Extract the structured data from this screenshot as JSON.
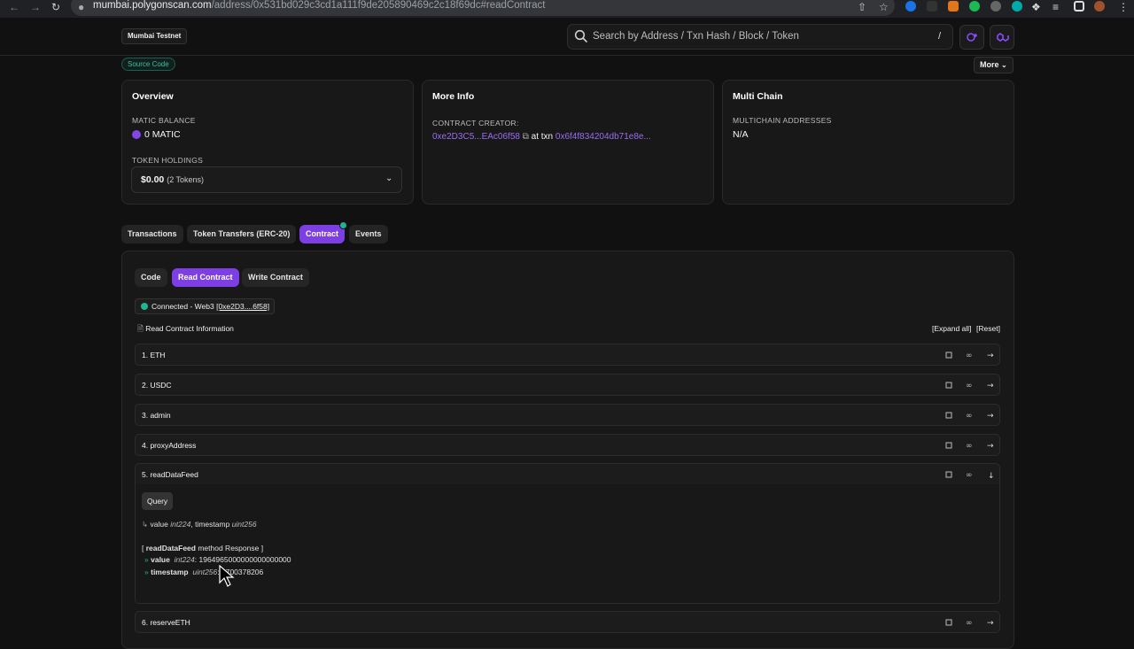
{
  "browser": {
    "url_host": "mumbai.polygonscan.com",
    "url_path": "/address/0x531bd029c3cd1a111f9de205890469c2c18f69dc#readContract"
  },
  "header": {
    "network": "Mumbai Testnet",
    "search_placeholder": "Search by Address / Txn Hash / Block / Token",
    "search_shortcut": "/"
  },
  "subheader": {
    "source_badge": "Source Code",
    "more_label": "More"
  },
  "overview": {
    "title": "Overview",
    "balance_label": "MATIC BALANCE",
    "balance_value": "0 MATIC",
    "holdings_label": "TOKEN HOLDINGS",
    "holdings_value": "$0.00",
    "holdings_count": "(2 Tokens)"
  },
  "more_info": {
    "title": "More Info",
    "creator_label": "CONTRACT CREATOR:",
    "creator_address": "0xe2D3C5...EAc06f58",
    "at_txn": "at txn",
    "creator_txn": "0x6f4f834204db71e8e..."
  },
  "multi_chain": {
    "title": "Multi Chain",
    "label": "MULTICHAIN ADDRESSES",
    "value": "N/A"
  },
  "tabs": [
    {
      "label": "Transactions"
    },
    {
      "label": "Token Transfers (ERC-20)"
    },
    {
      "label": "Contract"
    },
    {
      "label": "Events"
    }
  ],
  "subtabs": [
    {
      "label": "Code"
    },
    {
      "label": "Read Contract"
    },
    {
      "label": "Write Contract"
    }
  ],
  "connection": {
    "status": "Connected - Web3",
    "address": "[0xe2D3....6f58]"
  },
  "read_info": {
    "title": "Read Contract Information",
    "expand_all": "[Expand all]",
    "reset": "[Reset]"
  },
  "functions": [
    {
      "label": "1. ETH"
    },
    {
      "label": "2. USDC"
    },
    {
      "label": "3. admin"
    },
    {
      "label": "4. proxyAddress"
    },
    {
      "label": "5. readDataFeed"
    },
    {
      "label": "6. reserveETH"
    }
  ],
  "expanded": {
    "query_label": "Query",
    "outputs_prefix": "value",
    "outputs_type1": "int224",
    "outputs_sep": ", timestamp",
    "outputs_type2": "uint256",
    "response_open": "[",
    "response_method": "readDataFeed",
    "response_text": "method Response ]",
    "value_name": "value",
    "value_type": "int224",
    "value_val": "1964965000000000000000",
    "ts_name": "timestamp",
    "ts_type": "uint256",
    "ts_val": "1700378206"
  }
}
